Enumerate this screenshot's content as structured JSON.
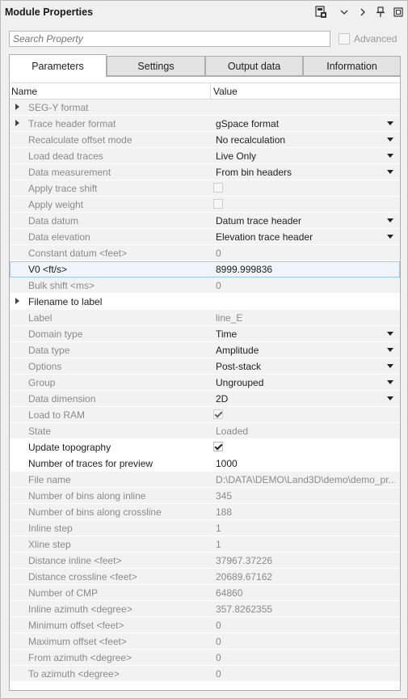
{
  "window": {
    "title": "Module Properties"
  },
  "search": {
    "placeholder": "Search Property"
  },
  "advanced_label": "Advanced",
  "tabs": [
    {
      "label": "Parameters"
    },
    {
      "label": "Settings"
    },
    {
      "label": "Output data"
    },
    {
      "label": "Information"
    }
  ],
  "grid": {
    "col_name": "Name",
    "col_value": "Value"
  },
  "rows": [
    {
      "name": "SEG-Y format",
      "value": ""
    },
    {
      "name": "Trace header format",
      "value": "gSpace format"
    },
    {
      "name": "Recalculate offset mode",
      "value": "No recalculation"
    },
    {
      "name": "Load dead traces",
      "value": "Live Only"
    },
    {
      "name": "Data measurement",
      "value": "From bin headers"
    },
    {
      "name": "Apply trace shift",
      "value": ""
    },
    {
      "name": "Apply weight",
      "value": ""
    },
    {
      "name": "Data datum",
      "value": "Datum trace header"
    },
    {
      "name": "Data elevation",
      "value": "Elevation trace header"
    },
    {
      "name": "Constant datum <feet>",
      "value": "0"
    },
    {
      "name": "V0 <ft/s>",
      "value": "8999.999836"
    },
    {
      "name": "Bulk shift <ms>",
      "value": "0"
    },
    {
      "name": "Filename to label",
      "value": ""
    },
    {
      "name": "Label",
      "value": "line_E"
    },
    {
      "name": "Domain type",
      "value": "Time"
    },
    {
      "name": "Data type",
      "value": "Amplitude"
    },
    {
      "name": "Options",
      "value": "Post-stack"
    },
    {
      "name": "Group",
      "value": "Ungrouped"
    },
    {
      "name": "Data dimension",
      "value": "2D"
    },
    {
      "name": "Load to RAM",
      "value": ""
    },
    {
      "name": "State",
      "value": "Loaded"
    },
    {
      "name": "Update topography",
      "value": ""
    },
    {
      "name": "Number of traces for preview",
      "value": "1000"
    },
    {
      "name": "File name",
      "value": "D:\\DATA\\DEMO\\Land3D\\demo\\demo_pr..."
    },
    {
      "name": "Number of bins along inline",
      "value": "345"
    },
    {
      "name": "Number of bins along crossline",
      "value": "188"
    },
    {
      "name": "Inline step",
      "value": "1"
    },
    {
      "name": "Xline step",
      "value": "1"
    },
    {
      "name": "Distance inline <feet>",
      "value": "37967.37226"
    },
    {
      "name": "Distance crossline <feet>",
      "value": "20689.67162"
    },
    {
      "name": "Number of CMP",
      "value": "64860"
    },
    {
      "name": "Inline azimuth <degree>",
      "value": "357.8262355"
    },
    {
      "name": "Minimum offset <feet>",
      "value": "0"
    },
    {
      "name": "Maximum offset <feet>",
      "value": "0"
    },
    {
      "name": "From azimuth <degree>",
      "value": "0"
    },
    {
      "name": "To azimuth <degree>",
      "value": "0"
    }
  ]
}
